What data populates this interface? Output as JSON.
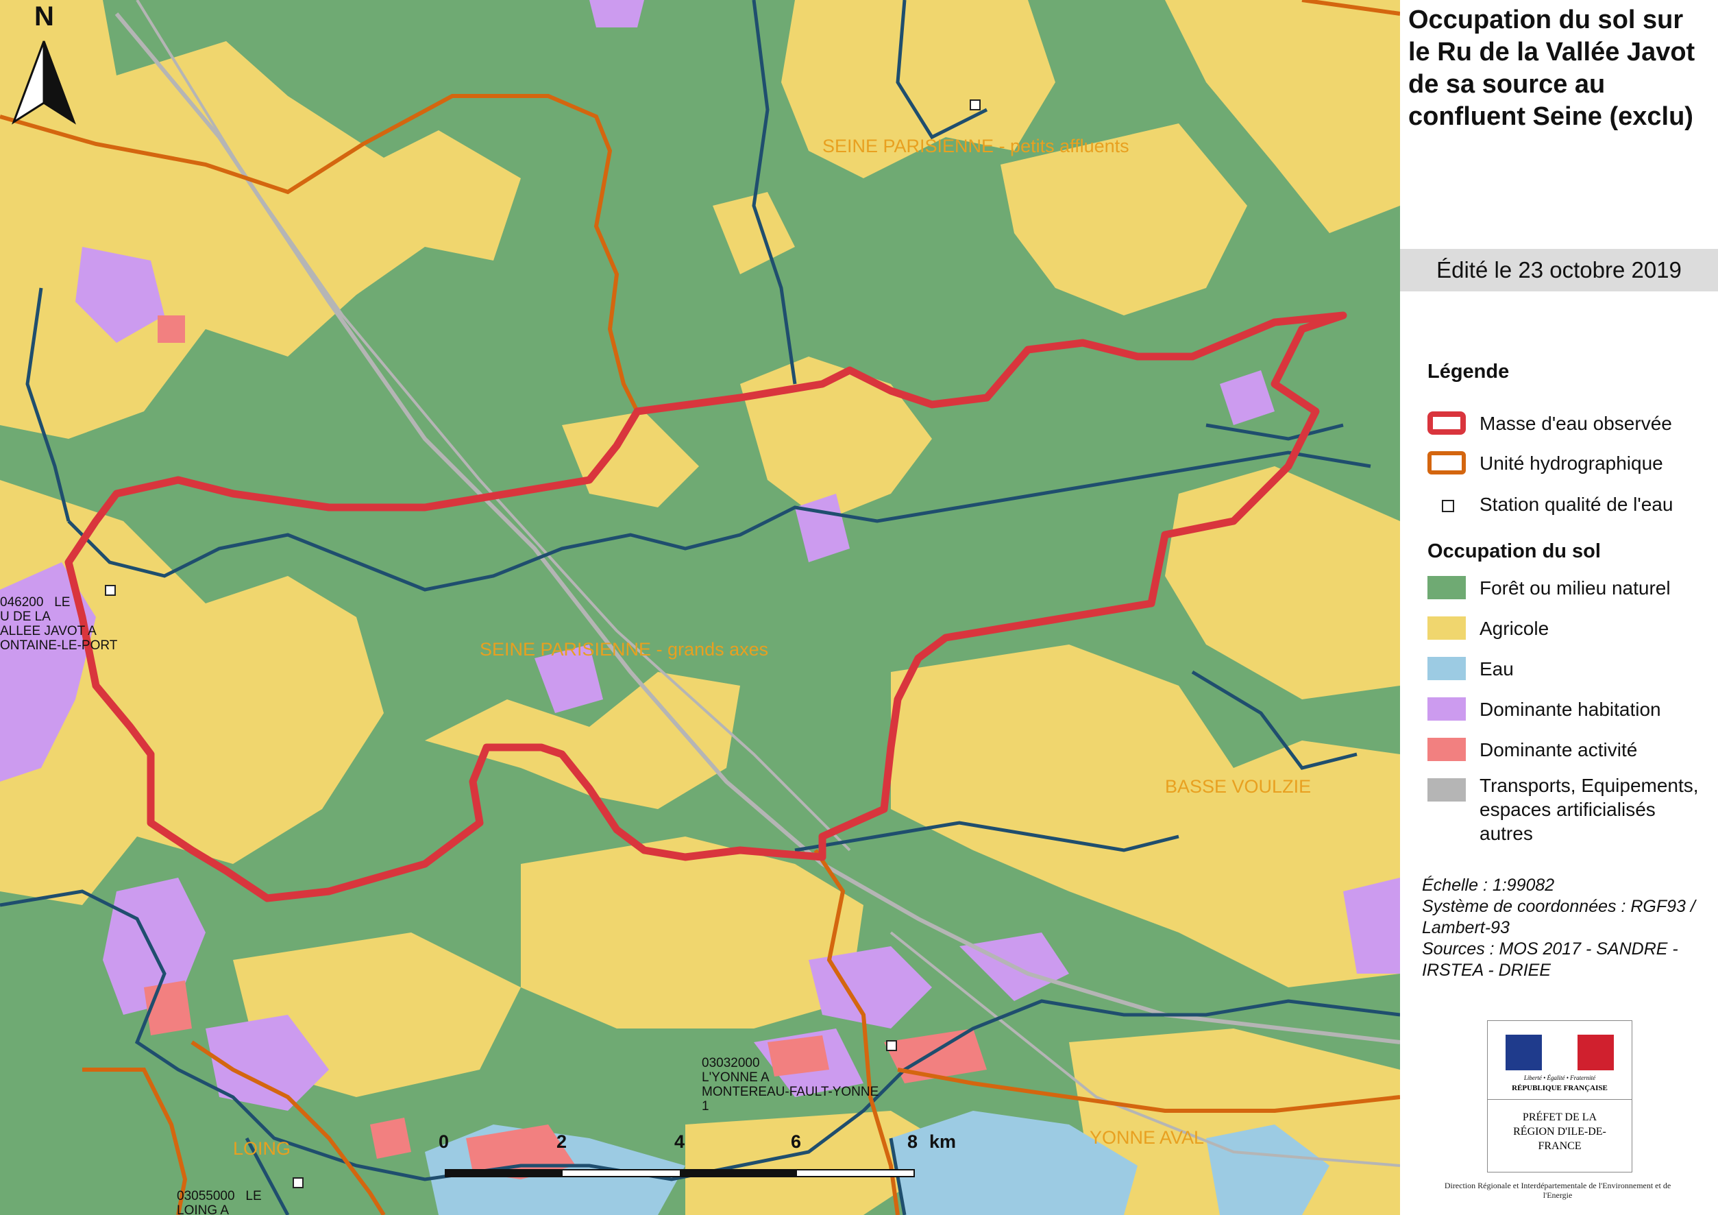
{
  "map": {
    "north_label": "N",
    "zone_labels": [
      {
        "id": "zone-seine-petits",
        "text": "SEINE PARISIENNE - petits affluents"
      },
      {
        "id": "zone-seine-grands",
        "text": "SEINE PARISIENNE - grands axes"
      },
      {
        "id": "zone-basse-voulzie",
        "text": "BASSE VOULZIE"
      },
      {
        "id": "zone-yonne-aval",
        "text": "YONNE AVAL"
      },
      {
        "id": "zone-loing",
        "text": "LOING"
      }
    ],
    "stations": [
      {
        "id": "station-javot",
        "text": "046200   LE\nU DE LA\nALLEE JAVOT A\nONTAINE-LE-PORT"
      },
      {
        "id": "station-yonne",
        "text": "03032000\nL'YONNE A\nMONTEREAU-FAULT-YONNE\n1"
      },
      {
        "id": "station-loing",
        "text": "03055000   LE\nLOING A"
      }
    ],
    "scale_labels": [
      "0",
      "2",
      "4",
      "6",
      "8",
      "km"
    ],
    "colors": {
      "forest": "#6faa73",
      "agricultural": "#f0d66e",
      "water": "#9ccbe3",
      "housing": "#cc9bef",
      "activity": "#f28080",
      "transport": "#b5b5b5",
      "river": "#1f4e6e",
      "observed_water_body": "#d9353d",
      "hydro_unit": "#d4660f",
      "zone_label": "#e8a020"
    }
  },
  "sidebar": {
    "title": "Occupation du sol sur le Ru de la Vallée Javot de sa source au confluent Seine (exclu)",
    "edited": "Édité le 23 octobre 2019",
    "legend_title": "Légende",
    "legend_lines": [
      {
        "label": "Masse d'eau observée",
        "icon": "red-outline-swatch",
        "color": "#d9353d"
      },
      {
        "label": "Unité hydrographique",
        "icon": "orange-outline-swatch",
        "color": "#d4660f"
      },
      {
        "label": "Station qualité de l'eau",
        "icon": "station-square-icon",
        "color": "#222222"
      }
    ],
    "land_use_title": "Occupation du sol",
    "land_use": [
      {
        "label": "Forêt ou milieu naturel",
        "color": "#6faa73"
      },
      {
        "label": "Agricole",
        "color": "#f0d66e"
      },
      {
        "label": "Eau",
        "color": "#9ccbe3"
      },
      {
        "label": "Dominante habitation",
        "color": "#cc9bef"
      },
      {
        "label": "Dominante activité",
        "color": "#f28080"
      },
      {
        "label": "Transports, Equipements, espaces artificialisés autres",
        "color": "#b5b5b5"
      }
    ],
    "scale_text": "Échelle :  1:99082",
    "crs_text": "Système de coordonnées : RGF93 / Lambert-93",
    "sources_text": "Sources : MOS 2017 - SANDRE - IRSTEA - DRIEE",
    "logo": {
      "motto": "Liberté • Égalité • Fraternité",
      "republic": "RÉPUBLIQUE FRANÇAISE",
      "prefect": "PRÉFET DE LA RÉGION D'ILE-DE-FRANCE",
      "direction": "Direction Régionale et Interdépartementale de l'Environnement et de l'Energie"
    }
  }
}
